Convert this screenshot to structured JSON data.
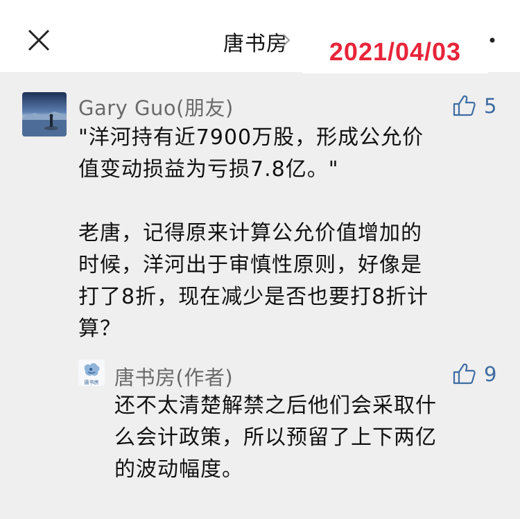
{
  "header": {
    "title": "唐书房",
    "date_stamp": "2021/04/03"
  },
  "comment": {
    "author": "Gary Guo(朋友)",
    "likes": "5",
    "text": "\"洋河持有近7900万股，形成公允价\n值变动损益为亏损7.8亿。\"\n\n老唐，记得原来计算公允价值增加的\n时候，洋河出于审慎性原则，好像是\n打了8折，现在减少是否也要打8折计\n算？"
  },
  "reply": {
    "author": "唐书房(作者)",
    "likes": "9",
    "avatar_label": "唐书房",
    "text": "还不太清楚解禁之后他们会采取什\n么会计政策，所以预留了上下两亿\n的波动幅度。"
  },
  "icons": {
    "close": "close-icon",
    "chevron": "chevron-right-icon",
    "more": "more-icon",
    "like": "thumbs-up-icon"
  },
  "colors": {
    "accent_blue": "#3e6ca2",
    "date_red": "#e8243a",
    "background": "#efefef"
  }
}
